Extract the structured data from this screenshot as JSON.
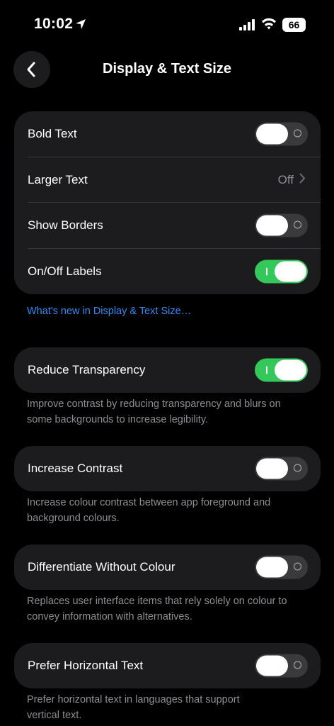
{
  "status_bar": {
    "time": "10:02",
    "battery": "66"
  },
  "nav": {
    "title": "Display & Text Size"
  },
  "group1": {
    "bold_text": {
      "label": "Bold Text",
      "on": false
    },
    "larger_text": {
      "label": "Larger Text",
      "value": "Off"
    },
    "show_borders": {
      "label": "Show Borders",
      "on": false
    },
    "onoff_labels": {
      "label": "On/Off Labels",
      "on": true
    }
  },
  "whats_new_link": "What's new in Display & Text Size…",
  "reduce_transparency": {
    "label": "Reduce Transparency",
    "on": true,
    "footnote_line1": "Improve contrast by reducing transparency and blurs on",
    "footnote_line2": "some backgrounds to increase legibility."
  },
  "increase_contrast": {
    "label": "Increase Contrast",
    "on": false,
    "footnote_line1": "Increase colour contrast between app foreground and",
    "footnote_line2": "background colours."
  },
  "differentiate_without_colour": {
    "label": "Differentiate Without Colour",
    "on": false,
    "footnote_line1": "Replaces user interface items that rely solely on colour to",
    "footnote_line2": "convey information with alternatives."
  },
  "prefer_horizontal_text": {
    "label": "Prefer Horizontal Text",
    "on": false,
    "footnote_line1": "Prefer horizontal text in languages that support",
    "footnote_line2": "vertical text."
  },
  "colors": {
    "accent_green": "#34c759",
    "link_blue": "#2f8bf5",
    "cell_bg": "#1c1c1e"
  }
}
